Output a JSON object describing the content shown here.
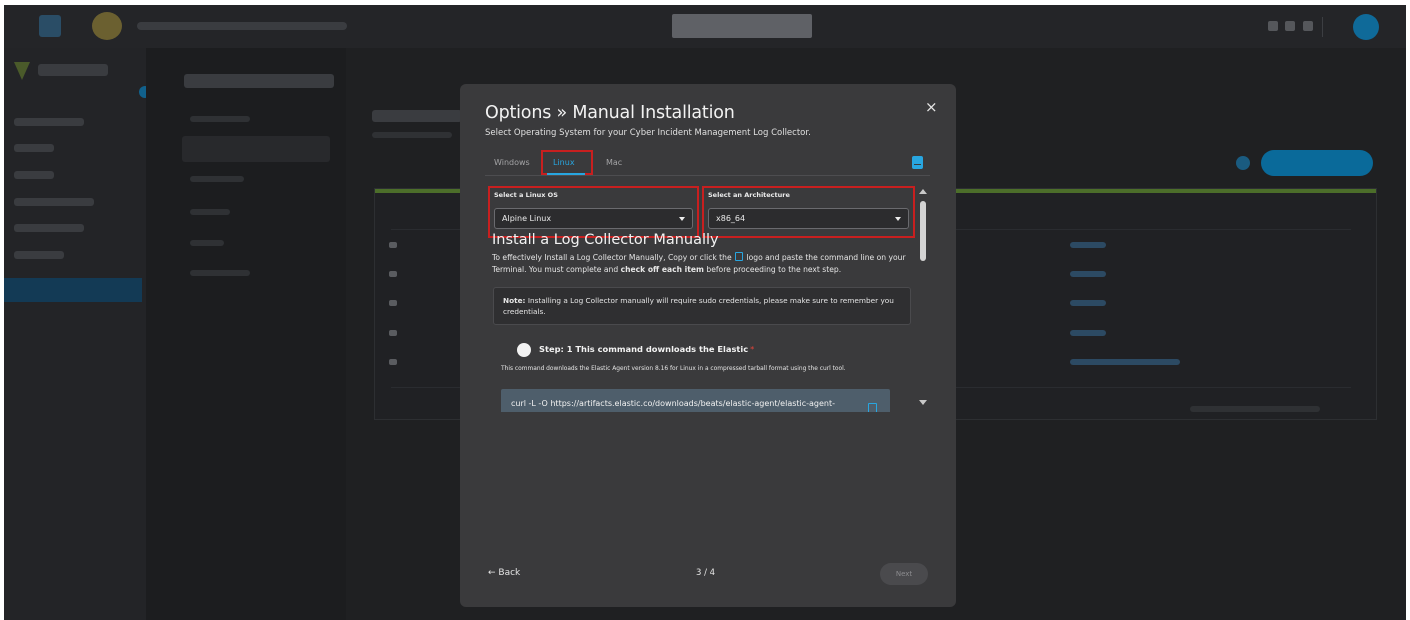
{
  "modal": {
    "title": "Options » Manual Installation",
    "subtitle": "Select Operating System for your Cyber Incident Management Log Collector.",
    "close": "×",
    "tabs": [
      {
        "label": "Windows",
        "active": false
      },
      {
        "label": "Linux",
        "active": true
      },
      {
        "label": "Mac",
        "active": false
      }
    ],
    "os_select": {
      "label": "Select a Linux OS",
      "value": "Alpine Linux"
    },
    "arch_select": {
      "label": "Select an Architecture",
      "value": "x86_64"
    },
    "install": {
      "title": "Install a Log Collector Manually",
      "desc_part1": "To effectively Install a Log Collector Manually, Copy or click the",
      "desc_part2": "logo and paste the command line on your Terminal. You must complete and",
      "desc_bold": "check off each item",
      "desc_part3": "before proceeding to the next step."
    },
    "note": {
      "bold": "Note:",
      "text": "Installing a Log Collector manually will require sudo credentials, please make sure to remember you credentials."
    },
    "step": {
      "title": "Step: 1 This command downloads the Elastic",
      "required_mark": "*",
      "desc": "This command downloads the Elastic Agent version 8.16 for Linux in a compressed tarball format using the curl tool.",
      "command": "curl -L -O https://artifacts.elastic.co/downloads/beats/elastic-agent/elastic-agent-"
    },
    "footer": {
      "back": "← Back",
      "page": "3 / 4",
      "next": "Next"
    }
  },
  "colors": {
    "accent": "#28a6e0",
    "highlight": "#c81f1f",
    "modal_bg": "#3a3a3c"
  },
  "icons": [
    "close-icon",
    "book-icon",
    "copy-icon",
    "chevron-down-icon",
    "arrow-left-icon"
  ]
}
